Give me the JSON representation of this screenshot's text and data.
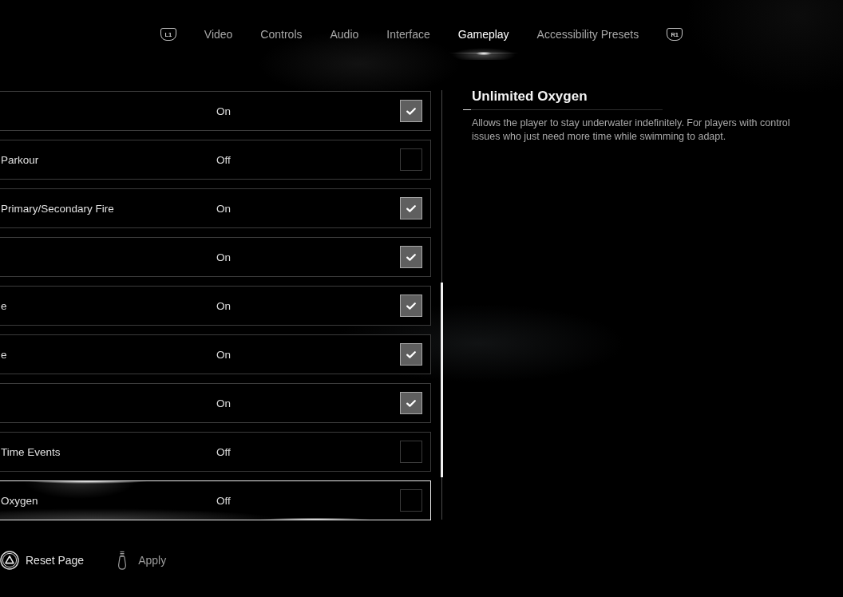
{
  "tab_bar": {
    "prev_key": "L1",
    "next_key": "R1",
    "tabs": [
      {
        "label": "Video",
        "selected": false
      },
      {
        "label": "Controls",
        "selected": false
      },
      {
        "label": "Audio",
        "selected": false
      },
      {
        "label": "Interface",
        "selected": false
      },
      {
        "label": "Gameplay",
        "selected": true
      },
      {
        "label": "Accessibility Presets",
        "selected": false
      }
    ]
  },
  "settings": [
    {
      "value": "On",
      "checked": true,
      "selected": false
    },
    {
      "label": "Parkour",
      "value": "Off",
      "checked": false,
      "selected": false
    },
    {
      "label": "Primary/Secondary Fire",
      "value": "On",
      "checked": true,
      "selected": false
    },
    {
      "value": "On",
      "checked": true,
      "selected": false
    },
    {
      "label": "e",
      "value": "On",
      "checked": true,
      "selected": false
    },
    {
      "label": "e",
      "value": "On",
      "checked": true,
      "selected": false
    },
    {
      "value": "On",
      "checked": true,
      "selected": false
    },
    {
      "label": "Time Events",
      "value": "Off",
      "checked": false,
      "selected": false
    },
    {
      "label": "Oxygen",
      "value": "Off",
      "checked": false,
      "selected": true
    }
  ],
  "detail": {
    "title": "Unlimited Oxygen",
    "description": "Allows the player to stay underwater indefinitely. For players with control\nissues who just need more time while swimming to adapt."
  },
  "actions": [
    {
      "kind": "triangle",
      "label": "Reset Page",
      "disabled": false
    },
    {
      "kind": "capsule",
      "label": "Apply",
      "disabled": true
    }
  ]
}
